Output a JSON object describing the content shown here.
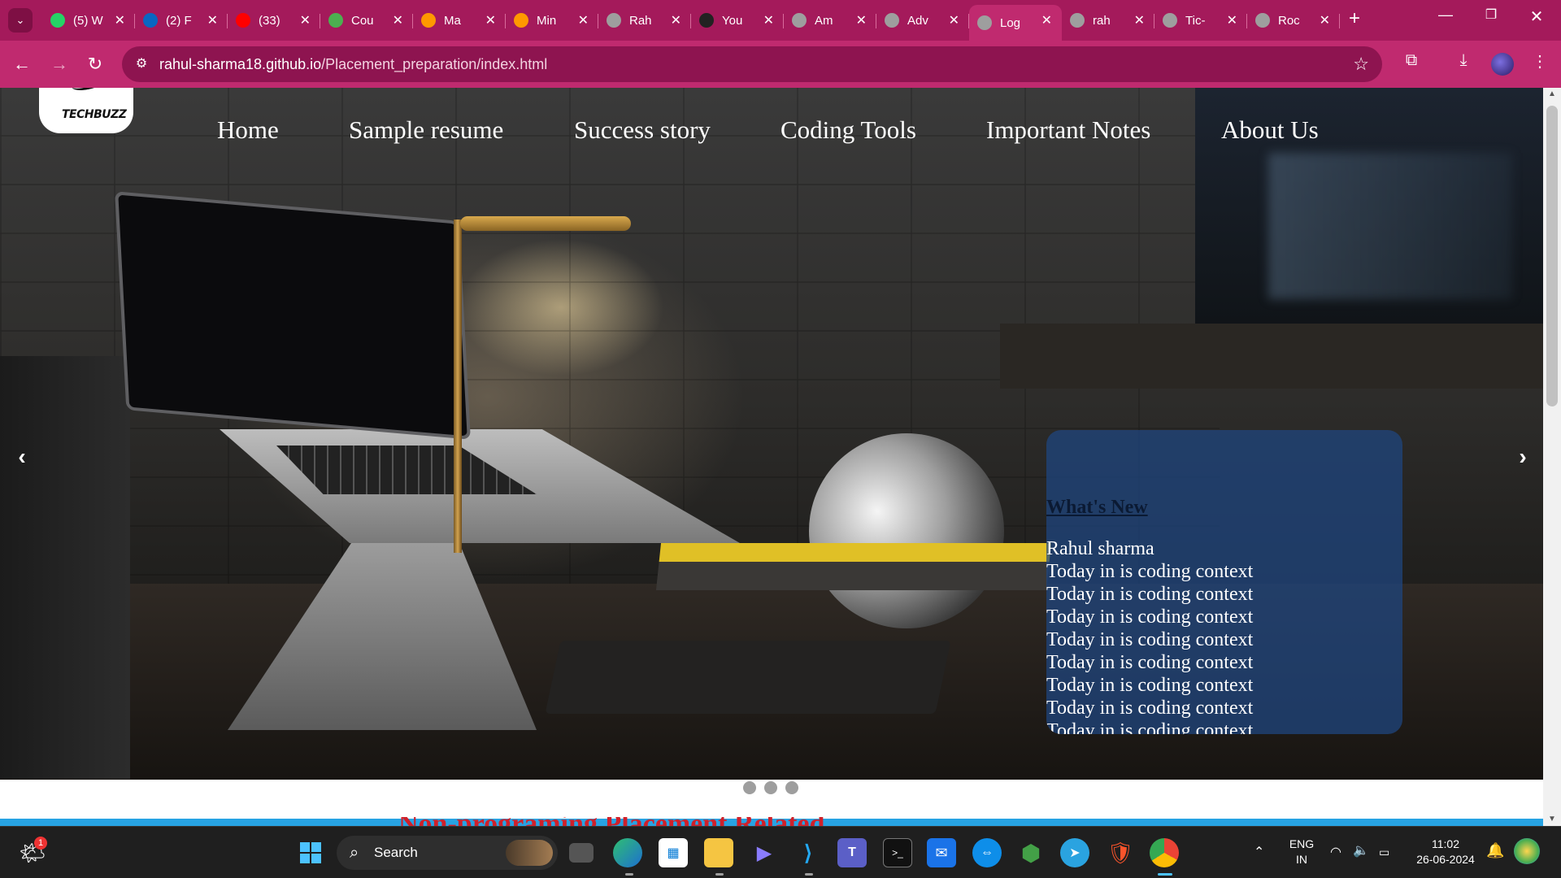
{
  "browser": {
    "tabs": [
      {
        "title": "(5) W",
        "icon": "whatsapp-icon",
        "color": "#25d366",
        "active": false
      },
      {
        "title": "(2) F",
        "icon": "linkedin-icon",
        "color": "#0a66c2",
        "active": false
      },
      {
        "title": "(33)",
        "icon": "youtube-icon",
        "color": "#ff0000",
        "active": false
      },
      {
        "title": "Cou",
        "icon": "coursera-icon",
        "color": "#4caf50",
        "active": false
      },
      {
        "title": "Ma",
        "icon": "bolt-icon",
        "color": "#ff9800",
        "active": false
      },
      {
        "title": "Min",
        "icon": "bolt-icon",
        "color": "#ff9800",
        "active": false
      },
      {
        "title": "Rah",
        "icon": "globe-icon",
        "color": "#9e9e9e",
        "active": false
      },
      {
        "title": "You",
        "icon": "github-icon",
        "color": "#222222",
        "active": false
      },
      {
        "title": "Am",
        "icon": "globe-icon",
        "color": "#9e9e9e",
        "active": false
      },
      {
        "title": "Adv",
        "icon": "globe-icon",
        "color": "#9e9e9e",
        "active": false
      },
      {
        "title": "Log",
        "icon": "globe-icon",
        "color": "#9e9e9e",
        "active": true
      },
      {
        "title": "rah",
        "icon": "globe-icon",
        "color": "#9e9e9e",
        "active": false
      },
      {
        "title": "Tic-",
        "icon": "globe-icon",
        "color": "#9e9e9e",
        "active": false
      },
      {
        "title": "Roc",
        "icon": "globe-icon",
        "color": "#9e9e9e",
        "active": false
      }
    ],
    "url_host": "rahul-sharma18.github.io",
    "url_path": "/Placement_preparation/index.html",
    "theme_color": "#c02a6f"
  },
  "site": {
    "logo_text": "TECHBUZZ",
    "nav": [
      "Home",
      "Sample resume",
      "Success story",
      "Coding Tools",
      "Important Notes",
      "About Us"
    ],
    "carousel_prev": "‹",
    "carousel_next": "›",
    "carousel_slide_count": 3,
    "news": {
      "title": "What's New",
      "items": [
        "Rahul sharma",
        "Today in is coding context",
        "Today in is coding context",
        "Today in is coding context",
        "Today in is coding context",
        "Today in is coding context",
        "Today in is coding context",
        "Today in is coding context",
        "Today in is coding context"
      ]
    },
    "section_heading": "Non-programing Placement Related"
  },
  "taskbar": {
    "search_label": "Search",
    "weather_badge": "1",
    "language_line1": "ENG",
    "language_line2": "IN",
    "time": "11:02",
    "date": "26-06-2024",
    "apps": [
      "windows-start-icon",
      "task-view-icon",
      "edge-icon",
      "store-icon",
      "file-explorer-icon",
      "media-icon",
      "vscode-icon",
      "teams-icon",
      "terminal-icon",
      "mail-icon",
      "teamviewer-icon",
      "shield-app-icon",
      "telegram-icon",
      "brave-icon",
      "chrome-icon"
    ]
  }
}
